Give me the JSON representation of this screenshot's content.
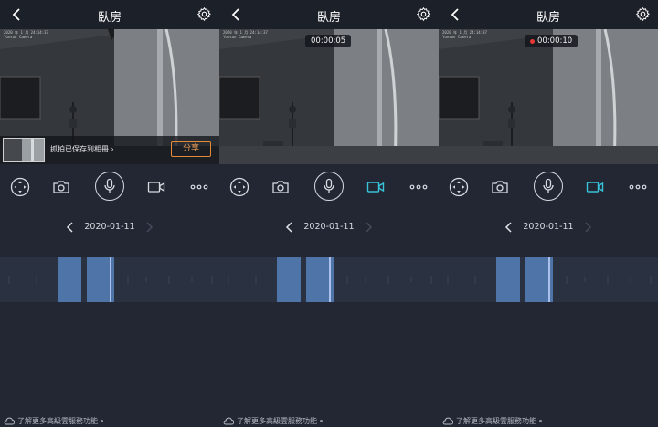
{
  "title": "臥房",
  "date": "2020-01-11",
  "cam_overlay": {
    "line1": "2020 年 1 月 24:14:37",
    "line2": "Yunsun Camera"
  },
  "snapshot": {
    "message": "抓拍已保存到相冊",
    "share_label": "分享"
  },
  "timers": [
    "00:00:05",
    "00:00:10"
  ],
  "footer_text": "了解更多高級雲服務功能",
  "controls": {
    "icons": [
      "direction-pad-icon",
      "camera-icon",
      "microphone-icon",
      "video-record-icon",
      "more-icon"
    ]
  },
  "colors": {
    "accent_active": "#38c3d8",
    "record_dot": "#e53935",
    "share_border": "#e58a3a",
    "timeline_bg": "#2a3140",
    "timeline_segment": "#4f74a8",
    "playhead": "#c9d8ff"
  },
  "screens": [
    {
      "record_active": false,
      "timer": null,
      "snapshot_visible": true
    },
    {
      "record_active": true,
      "timer": "00:00:05",
      "snapshot_visible": false
    },
    {
      "record_active": true,
      "timer": "00:00:10",
      "recording_dot": true,
      "snapshot_visible": false
    }
  ]
}
